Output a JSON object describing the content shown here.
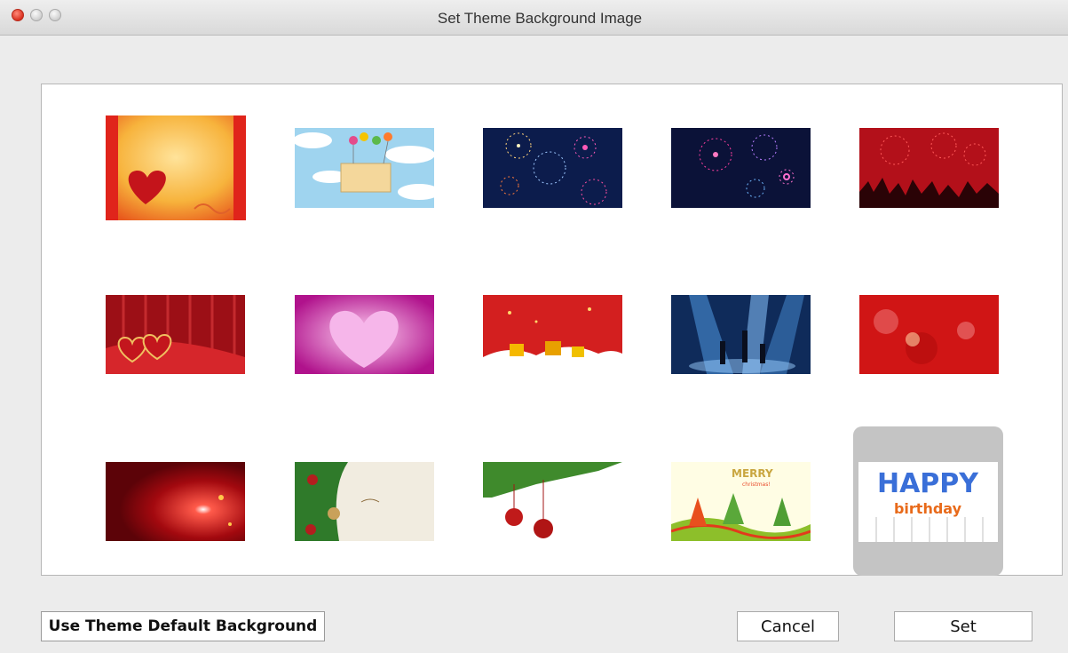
{
  "window": {
    "title": "Set Theme Background Image"
  },
  "thumbnails": [
    {
      "name": "thumb-valentine-heart-orange",
      "selected": false
    },
    {
      "name": "thumb-sky-balloons",
      "selected": false
    },
    {
      "name": "thumb-fireworks-blue",
      "selected": false
    },
    {
      "name": "thumb-fireworks-dark",
      "selected": false
    },
    {
      "name": "thumb-red-party-crowd",
      "selected": false
    },
    {
      "name": "thumb-red-curtain-hearts",
      "selected": false
    },
    {
      "name": "thumb-pink-heart-rays",
      "selected": false
    },
    {
      "name": "thumb-christmas-red-gifts",
      "selected": false
    },
    {
      "name": "thumb-stage-dancers",
      "selected": false
    },
    {
      "name": "thumb-red-bokeh-ornaments",
      "selected": false
    },
    {
      "name": "thumb-red-sparkle",
      "selected": false
    },
    {
      "name": "thumb-christmas-branch-cream",
      "selected": false
    },
    {
      "name": "thumb-christmas-branch-baubles",
      "selected": false
    },
    {
      "name": "thumb-merry-christmas-trees",
      "selected": false
    },
    {
      "name": "thumb-happy-birthday",
      "selected": true
    }
  ],
  "card_text": {
    "merry": "MERRY",
    "merry_sub": "christmas!",
    "happy": "HAPPY",
    "birthday": "birthday"
  },
  "buttons": {
    "default_bg": "Use Theme Default Background",
    "cancel": "Cancel",
    "set": "Set"
  },
  "colors": {
    "selection": "#c4c4c4",
    "window_bg": "#ececec"
  }
}
